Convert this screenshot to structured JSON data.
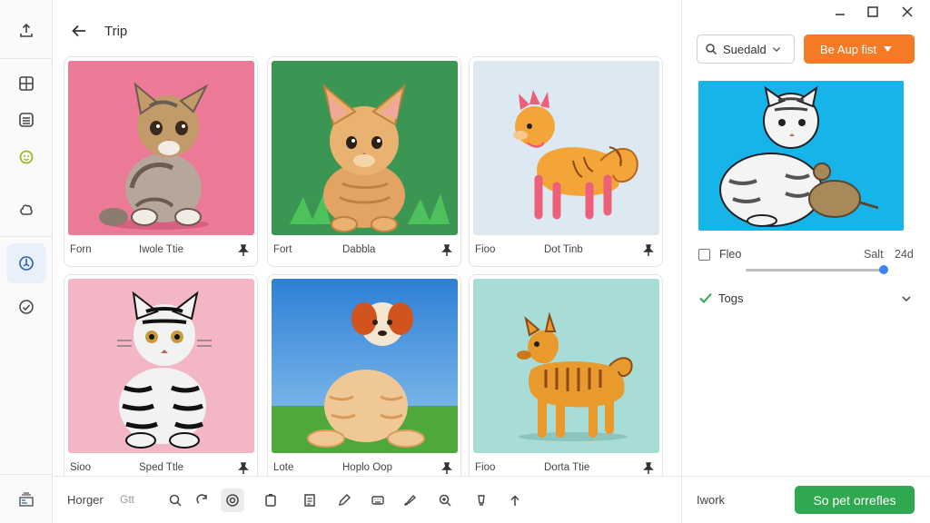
{
  "header": {
    "title": "Trip"
  },
  "colors": {
    "accent_orange": "#f47a25",
    "accent_green": "#2fa84f",
    "accent_blue": "#3b82f6"
  },
  "rail": {
    "icons": [
      "upload-icon",
      "grid-icon",
      "list-icon",
      "emoji-icon",
      "puzzle-icon",
      "sync-icon",
      "check-circle-icon",
      "gallery-icon"
    ]
  },
  "cards": [
    {
      "key": "Forn",
      "value": "Iwole Ttie",
      "bg": "#ec7a96",
      "animal": "kitten-tabby"
    },
    {
      "key": "Fort",
      "value": "Dabbla",
      "bg": "#3b9653",
      "animal": "kitten-ginger"
    },
    {
      "key": "Fioo",
      "value": "Dot Tinb",
      "bg": "#dce9f3",
      "animal": "fox-dog"
    },
    {
      "key": "Sioo",
      "value": "Sped Ttle",
      "bg": "#f3b6c5",
      "animal": "kitten-striped"
    },
    {
      "key": "Lote",
      "value": "Hoplo Oop",
      "bg": "#5aa6e0",
      "animal": "puppy-meadow"
    },
    {
      "key": "Fioo",
      "value": "Dorta Ttie",
      "bg": "#a8dcd6",
      "animal": "tiger-dog"
    }
  ],
  "toolbar": {
    "label": "Horger",
    "sub": "Gtt",
    "icons": [
      "zoom-out-icon",
      "redo-icon",
      "target-icon",
      "clipboard-icon",
      "document-icon",
      "pen-icon",
      "keyboard-icon",
      "brush-icon",
      "zoom-in-icon",
      "lamp-icon",
      "share-icon"
    ]
  },
  "right": {
    "select_label": "Suedald",
    "orange_button": "Be Aup fist",
    "check_label": "Fleo",
    "slider_label": "Salt",
    "slider_value": "24d",
    "slider_fraction": 1.0,
    "tags_label": "Togs",
    "footer_label": "Iwork",
    "green_button": "So pet orrefles"
  }
}
